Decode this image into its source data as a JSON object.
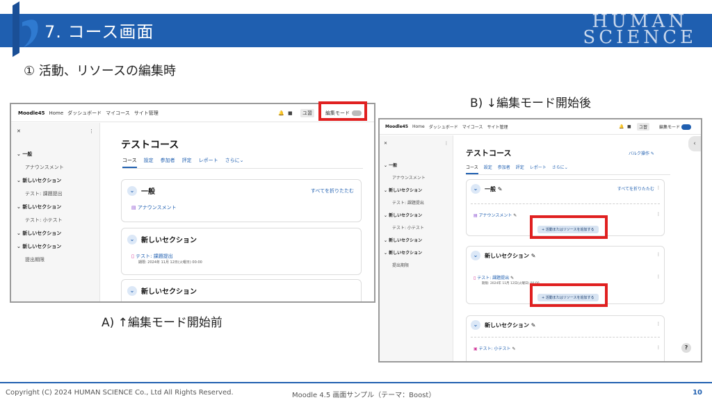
{
  "header": {
    "title": "7. コース画面",
    "brand_top": "HUMAN",
    "brand_bottom": "SCIENCE"
  },
  "subtitle": "① 活動、リソースの編集時",
  "caption_a": "A) ↑編集モード開始前",
  "caption_b": "B) ↓編集モード開始後",
  "shot_a": {
    "site": "Moodle45",
    "nav": [
      "Home",
      "ダッシュボード",
      "マイコース",
      "サイト管理"
    ],
    "user": "ユ習",
    "edit_mode_label": "編集モード",
    "sidebar": [
      {
        "label": "一般",
        "type": "sec"
      },
      {
        "label": "アナウンスメント",
        "type": "act"
      },
      {
        "label": "新しいセクション",
        "type": "sec"
      },
      {
        "label": "テスト: 課題提出",
        "type": "act"
      },
      {
        "label": "新しいセクション",
        "type": "sec"
      },
      {
        "label": "テスト: 小テスト",
        "type": "act"
      },
      {
        "label": "新しいセクション",
        "type": "sec"
      },
      {
        "label": "新しいセクション",
        "type": "sec"
      },
      {
        "label": "提出期限",
        "type": "act"
      }
    ],
    "course_title": "テストコース",
    "tabs": [
      "コース",
      "設定",
      "参加者",
      "評定",
      "レポート",
      "さらに⌄"
    ],
    "collapse_all": "すべてを折りたたむ",
    "section1": "一般",
    "announcement": "アナウンスメント",
    "section2": "新しいセクション",
    "assign": "テスト: 課題提出",
    "assign_due": "期限: 2024年 11月 12日(火曜日) 00:00",
    "section3": "新しいセクション"
  },
  "shot_b": {
    "site": "Moodle45",
    "nav": [
      "Home",
      "ダッシュボード",
      "マイコース",
      "サイト管理"
    ],
    "user": "ユ習",
    "edit_mode_label": "編集モード",
    "sidebar": [
      {
        "label": "一般",
        "type": "sec"
      },
      {
        "label": "アナウンスメント",
        "type": "act"
      },
      {
        "label": "新しいセクション",
        "type": "sec"
      },
      {
        "label": "テスト: 課題提出",
        "type": "act"
      },
      {
        "label": "新しいセクション",
        "type": "sec"
      },
      {
        "label": "テスト: 小テスト",
        "type": "act"
      },
      {
        "label": "新しいセクション",
        "type": "sec"
      },
      {
        "label": "新しいセクション",
        "type": "sec"
      },
      {
        "label": "提出期限",
        "type": "act"
      }
    ],
    "course_title": "テストコース",
    "bulk_edit": "バルク操作",
    "tabs": [
      "コース",
      "設定",
      "参加者",
      "評定",
      "レポート",
      "さらに⌄"
    ],
    "collapse_all": "すべてを折りたたむ",
    "section1": "一般",
    "announcement": "アナウンスメント",
    "add_activity": "+ 活動またはリソースを追加する",
    "section2": "新しいセクション",
    "assign": "テスト: 課題提出",
    "assign_due": "期限: 2024年 11月 12日(火曜日) 00:00",
    "section3": "新しいセクション",
    "quiz": "テスト: 小テスト",
    "help": "?"
  },
  "footer": {
    "copyright": "Copyright (C) 2024 HUMAN SCIENCE Co., Ltd All Rights Reserved.",
    "center": "Moodle 4.5 画面サンプル（テーマ：Boost）",
    "page": "10"
  },
  "colors": {
    "accent": "#1f5fb0",
    "highlight": "#e02020"
  }
}
